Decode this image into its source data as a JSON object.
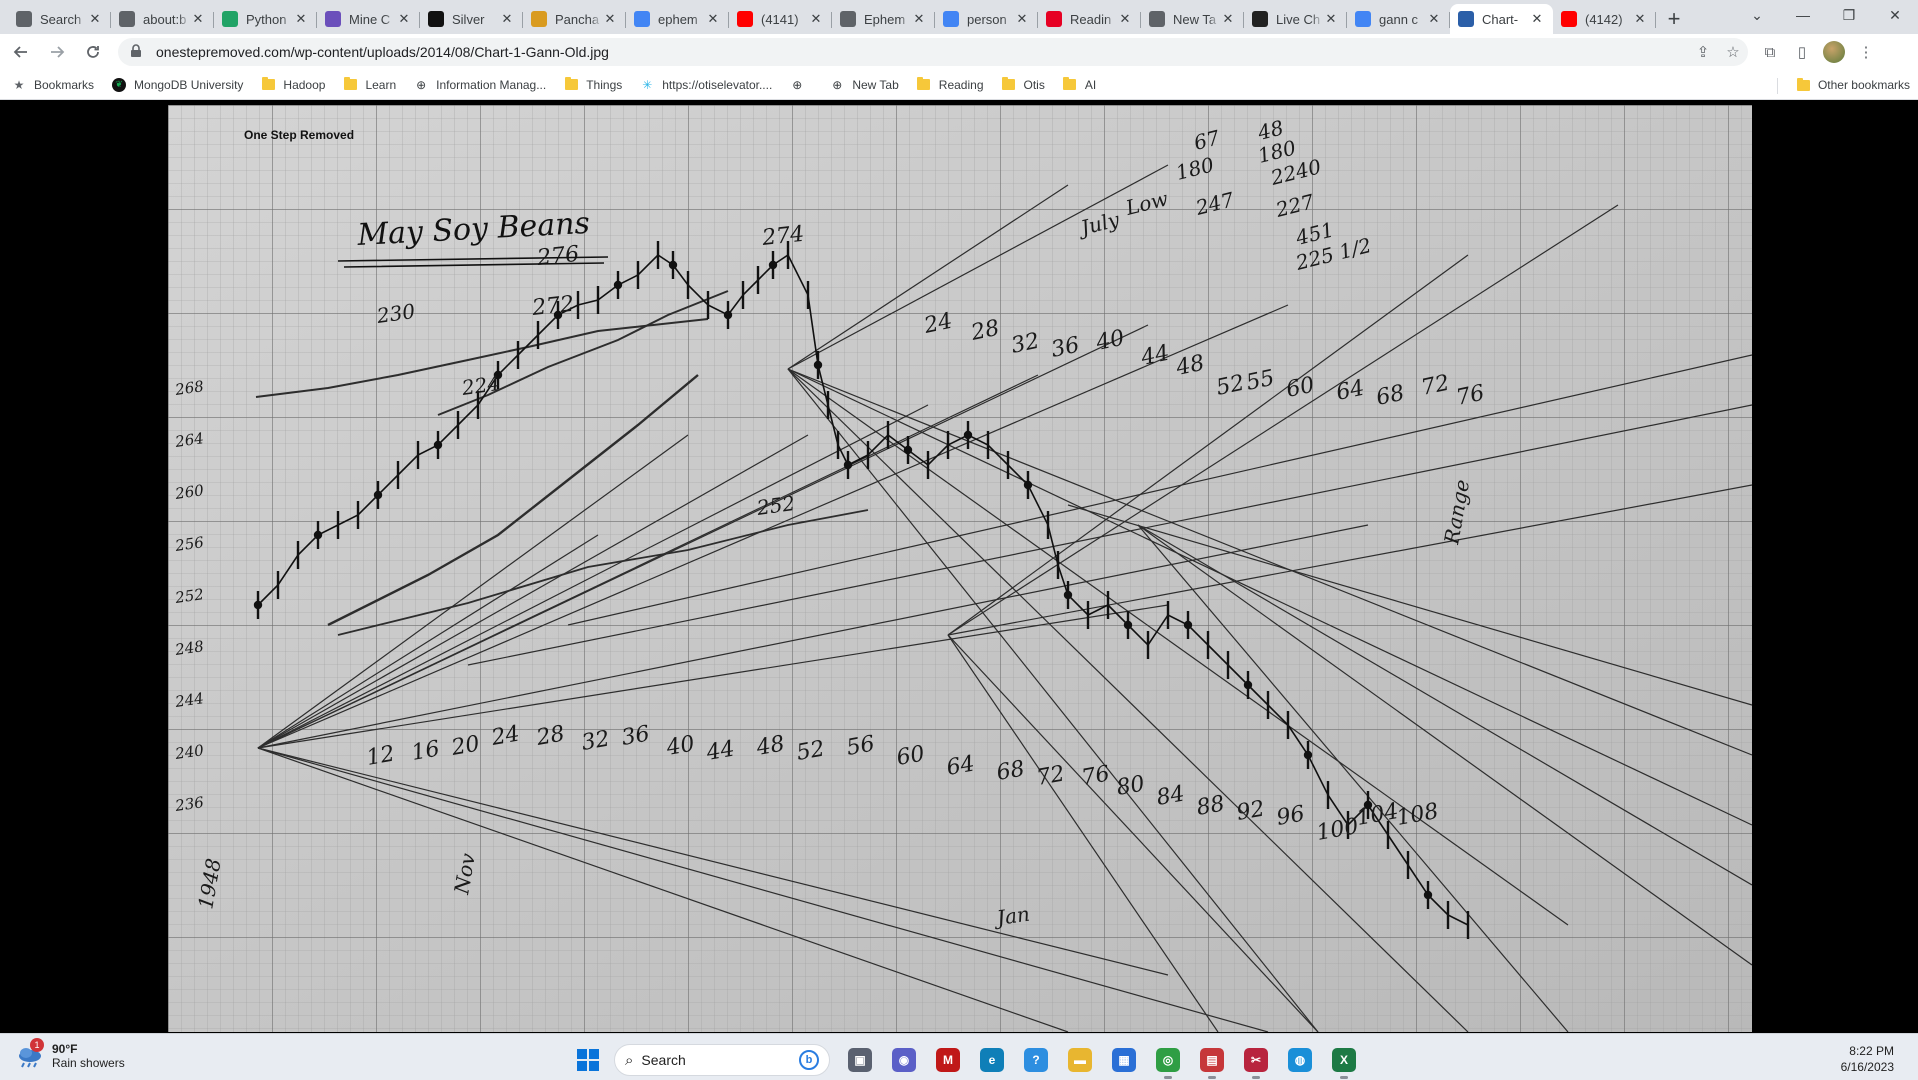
{
  "browser": {
    "tabs": [
      {
        "title": "Search",
        "icon": "search-icon",
        "color": "#5f6368"
      },
      {
        "title": "about:b",
        "icon": "globe-icon",
        "color": "#5f6368"
      },
      {
        "title": "Python",
        "icon": "w-logo-icon",
        "color": "#21a366"
      },
      {
        "title": "Mine C",
        "icon": "shield-icon",
        "color": "#6b4fbb"
      },
      {
        "title": "Silver",
        "icon": "notion-icon",
        "color": "#111111"
      },
      {
        "title": "Pancha",
        "icon": "pineapple-icon",
        "color": "#d99b20"
      },
      {
        "title": "ephem",
        "icon": "google-icon",
        "color": "#4285f4"
      },
      {
        "title": "(4141)",
        "icon": "youtube-icon",
        "color": "#ff0000"
      },
      {
        "title": "Ephem",
        "icon": "globe-icon",
        "color": "#5f6368"
      },
      {
        "title": "person",
        "icon": "google-icon",
        "color": "#4285f4"
      },
      {
        "title": "Readin",
        "icon": "pinterest-icon",
        "color": "#e60023"
      },
      {
        "title": "New Ta",
        "icon": "globe-icon",
        "color": "#5f6368"
      },
      {
        "title": "Live Ch",
        "icon": "investing-icon",
        "color": "#222222"
      },
      {
        "title": "gann c",
        "icon": "google-icon",
        "color": "#4285f4"
      },
      {
        "title": "Chart-",
        "icon": "page-icon",
        "color": "#2b5fa8",
        "active": true
      },
      {
        "title": "(4142)",
        "icon": "youtube-icon",
        "color": "#ff0000"
      }
    ],
    "url": "onestepremoved.com/wp-content/uploads/2014/08/Chart-1-Gann-Old.jpg",
    "bookmarks": [
      {
        "label": "Bookmarks",
        "icon": "star-icon"
      },
      {
        "label": "MongoDB University",
        "icon": "mongodb-leaf-icon"
      },
      {
        "label": "Hadoop",
        "icon": "folder-icon"
      },
      {
        "label": "Learn",
        "icon": "folder-icon"
      },
      {
        "label": "Information Manag...",
        "icon": "globe-icon"
      },
      {
        "label": "Things",
        "icon": "folder-icon"
      },
      {
        "label": "https://otiselevator....",
        "icon": "snowflake-icon"
      },
      {
        "label": "",
        "icon": "globe-icon"
      },
      {
        "label": "New Tab",
        "icon": "globe-icon"
      },
      {
        "label": "Reading",
        "icon": "folder-icon"
      },
      {
        "label": "Otis",
        "icon": "folder-icon"
      },
      {
        "label": "AI",
        "icon": "folder-icon"
      }
    ],
    "other_bookmarks": "Other bookmarks"
  },
  "image": {
    "watermark": "One Step Removed",
    "title": "May Soy Beans",
    "price_labels": [
      "268",
      "264",
      "260",
      "256",
      "252",
      "248",
      "244",
      "240",
      "236"
    ],
    "top_right_notes": [
      "July",
      "Low",
      "67",
      "180",
      "247",
      "48",
      "180",
      "2240",
      "227",
      "451",
      "225 1/2"
    ],
    "peak_labels": [
      "276",
      "272",
      "274"
    ],
    "count_numbers_bottom": [
      "12",
      "16",
      "20",
      "24",
      "28",
      "32",
      "36",
      "40",
      "44",
      "48",
      "52",
      "56",
      "60",
      "64",
      "68",
      "72",
      "76",
      "80",
      "84",
      "88",
      "92",
      "96",
      "100",
      "104",
      "108"
    ],
    "count_numbers_top": [
      "24",
      "28",
      "32",
      "36",
      "40",
      "44",
      "48",
      "52",
      "55",
      "60",
      "64",
      "68",
      "72",
      "76"
    ],
    "misc_annotations": [
      "252",
      "224",
      "230",
      "Jan",
      "Nov",
      "Range",
      "1948"
    ]
  },
  "taskbar": {
    "weather_temp": "90°F",
    "weather_desc": "Rain showers",
    "weather_badge": "1",
    "search_placeholder": "Search",
    "time": "8:22 PM",
    "date": "6/16/2023",
    "apps": [
      {
        "name": "task-view",
        "icon": "task-view-icon",
        "color": "#5a6170",
        "running": false
      },
      {
        "name": "teams",
        "icon": "teams-icon",
        "color": "#5b5fc7",
        "running": false
      },
      {
        "name": "mcafee",
        "icon": "mcafee-icon",
        "color": "#c01818",
        "running": false
      },
      {
        "name": "edge",
        "icon": "edge-icon",
        "color": "#0f7fb8",
        "running": false
      },
      {
        "name": "help",
        "icon": "help-icon",
        "color": "#2d8ee0",
        "running": false
      },
      {
        "name": "file-explorer",
        "icon": "folder-icon",
        "color": "#e8b630",
        "running": false
      },
      {
        "name": "store",
        "icon": "store-icon",
        "color": "#2a6fd6",
        "running": false
      },
      {
        "name": "chrome",
        "icon": "chrome-icon",
        "color": "#2f9e44",
        "running": true
      },
      {
        "name": "app-red",
        "icon": "chart-app-icon",
        "color": "#c6373a",
        "running": true
      },
      {
        "name": "snipping",
        "icon": "snip-icon",
        "color": "#b8243e",
        "running": true
      },
      {
        "name": "globe-app",
        "icon": "globe-app-icon",
        "color": "#1a8fd8",
        "running": false
      },
      {
        "name": "excel",
        "icon": "excel-icon",
        "color": "#1d7a45",
        "running": true
      }
    ]
  }
}
